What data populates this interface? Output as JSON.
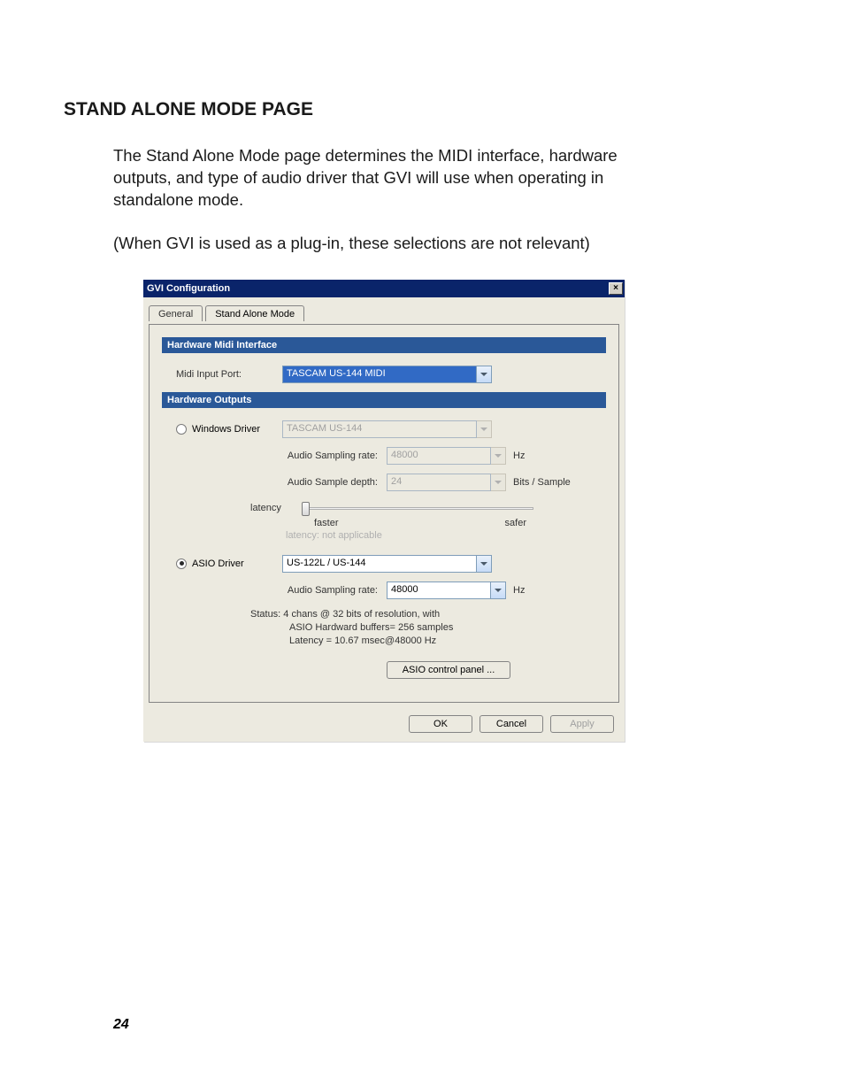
{
  "heading": "STAND ALONE MODE PAGE",
  "para1": "The Stand Alone Mode page determines the MIDI interface, hardware outputs, and type of audio driver that GVI will use when operating in standalone mode.",
  "para2": "(When GVI is used as a plug-in, these selections are not relevant)",
  "dialog": {
    "title": "GVI Configuration",
    "close_x": "×",
    "tabs": {
      "general": "General",
      "standalone": "Stand Alone Mode"
    },
    "midi_section": "Hardware Midi Interface",
    "midi_label": "Midi Input Port:",
    "midi_value": "TASCAM US-144 MIDI",
    "outputs_section": "Hardware Outputs",
    "win_driver_label": "Windows Driver",
    "win_driver_value": "TASCAM US-144",
    "win_rate_label": "Audio Sampling rate:",
    "win_rate_value": "48000",
    "win_rate_unit": "Hz",
    "win_depth_label": "Audio Sample depth:",
    "win_depth_value": "24",
    "win_depth_unit": "Bits / Sample",
    "latency_label": "latency",
    "faster": "faster",
    "safer": "safer",
    "latency_na": "latency: not applicable",
    "asio_driver_label": "ASIO Driver",
    "asio_driver_value": "US-122L / US-144",
    "asio_rate_label": "Audio Sampling rate:",
    "asio_rate_value": "48000",
    "asio_rate_unit": "Hz",
    "status_l1": "Status:  4 chans @ 32 bits of resolution, with",
    "status_l2": "ASIO Hardward buffers= 256 samples",
    "status_l3": "Latency = 10.67 msec@48000 Hz",
    "asio_panel_btn": "ASIO control panel ...",
    "ok": "OK",
    "cancel": "Cancel",
    "apply": "Apply"
  },
  "pagenum": "24"
}
